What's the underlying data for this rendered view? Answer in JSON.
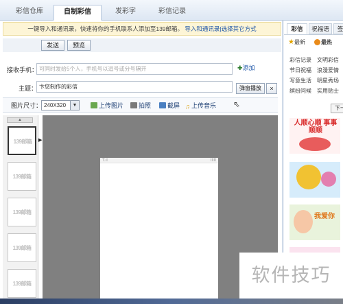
{
  "tabs": [
    {
      "label": "彩信仓库",
      "active": false
    },
    {
      "label": "自制彩信",
      "active": true
    },
    {
      "label": "发彩字",
      "active": false
    },
    {
      "label": "彩信记录",
      "active": false
    }
  ],
  "notice": {
    "text": "一键导入和通讯录，快速将你的手机联系人添加至139邮箱。",
    "import_link": "导入和通讯录",
    "separator": "|",
    "other_link": "选择其它方式"
  },
  "actions": {
    "send": "发送",
    "preview": "预览"
  },
  "form": {
    "recipient_label": "接收手机：",
    "recipient_placeholder": "可同时发给5个人，手机号以逗号或分号隔开",
    "add_label": "添加",
    "subject_label": "主题：",
    "subject_value": "卞您制作的彩信",
    "popup_button": "弹窗播放",
    "close": "×"
  },
  "toolbar": {
    "size_label": "图片尺寸：",
    "size_value": "240X320",
    "upload_image": "上传图片",
    "take_photo": "拍照",
    "screenshot": "截屏",
    "upload_music": "上传音乐"
  },
  "thumbnails": {
    "items": [
      "139邮箱",
      "139邮箱",
      "139邮箱",
      "139邮箱",
      "139邮箱"
    ],
    "selected_index": 0
  },
  "phone": {
    "signal": "T.ıl",
    "battery": "IIIII"
  },
  "sidebar": {
    "tabs": [
      "彩信",
      "祝福语",
      "签"
    ],
    "filters": [
      "最新",
      "最热"
    ],
    "categories": [
      "彩信记录",
      "文明彩信",
      "节日祝福",
      "浪漫爱情",
      "写意生活",
      "明星秀场",
      "缤纷问候",
      "实用贴士"
    ],
    "next_button": "下一"
  },
  "cards": [
    {
      "text": "人顺心顺 事事顺顺",
      "color": "#d92b2b"
    },
    {
      "text": "",
      "color": "#f1c232"
    },
    {
      "text": "我爱你",
      "color": "#e07a1f"
    }
  ],
  "watermark": "软件技巧",
  "colors": {
    "accent": "#1d55a8",
    "notice_bg": "#fdf5d6",
    "canvas_bg": "#808080"
  }
}
